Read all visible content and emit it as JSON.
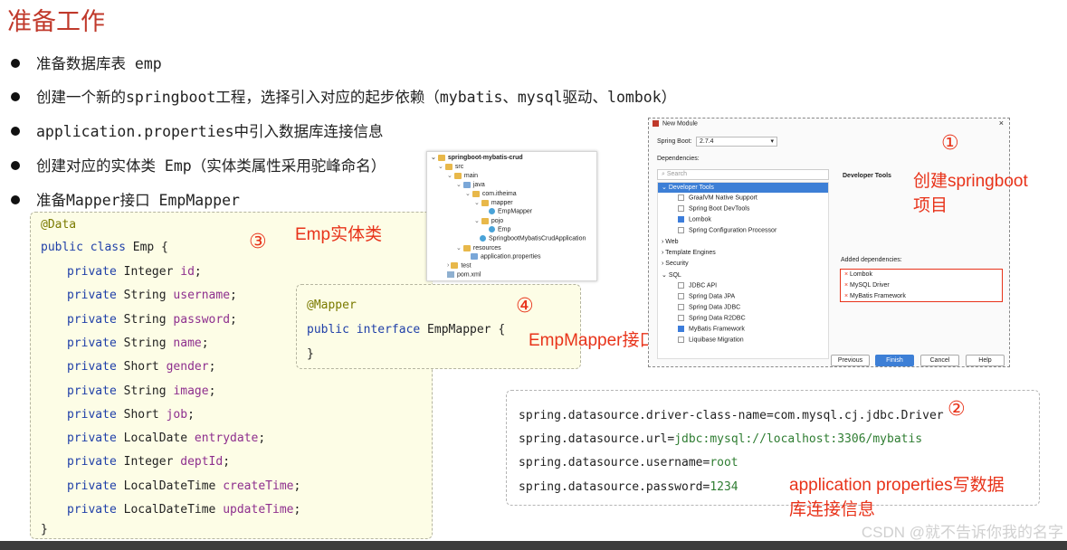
{
  "title": "准备工作",
  "bullets": [
    "准备数据库表 emp",
    "创建一个新的springboot工程，选择引入对应的起步依赖（mybatis、mysql驱动、lombok）",
    "application.properties中引入数据库连接信息",
    "创建对应的实体类 Emp（实体类属性采用驼峰命名）",
    "准备Mapper接口 EmpMapper"
  ],
  "emp_code": {
    "annotation": "@Data",
    "decl_kw": "public class",
    "decl_name": " Emp {",
    "fields": [
      {
        "kw": "private",
        "type": "Integer",
        "name": "id"
      },
      {
        "kw": "private",
        "type": "String",
        "name": "username"
      },
      {
        "kw": "private",
        "type": "String",
        "name": "password"
      },
      {
        "kw": "private",
        "type": "String",
        "name": "name"
      },
      {
        "kw": "private",
        "type": "Short",
        "name": "gender"
      },
      {
        "kw": "private",
        "type": "String",
        "name": "image"
      },
      {
        "kw": "private",
        "type": "Short",
        "name": "job"
      },
      {
        "kw": "private",
        "type": "LocalDate",
        "name": "entrydate"
      },
      {
        "kw": "private",
        "type": "Integer",
        "name": "deptId"
      },
      {
        "kw": "private",
        "type": "LocalDateTime",
        "name": "createTime"
      },
      {
        "kw": "private",
        "type": "LocalDateTime",
        "name": "updateTime"
      }
    ],
    "close": "}"
  },
  "mapper_code": {
    "annotation": "@Mapper",
    "decl_kw": "public interface",
    "decl_name": " EmpMapper {",
    "close": "}"
  },
  "labels": {
    "circle1": "①",
    "circle2": "②",
    "circle3": "③",
    "circle4": "④",
    "emp_label": "Emp实体类",
    "mapper_label": "EmpMapper接口类",
    "create_label_1": "创建springboot",
    "create_label_2": "项目",
    "props_label_1": "application properties写数据",
    "props_label_2": "库连接信息"
  },
  "tree": {
    "items": [
      "springboot-mybatis-crud",
      "src",
      "main",
      "java",
      "com.itheima",
      "mapper",
      "EmpMapper",
      "pojo",
      "Emp",
      "SpringbootMybatisCrudApplication",
      "resources",
      "application.properties",
      "test",
      "pom.xml"
    ]
  },
  "dialog": {
    "title": "New Module",
    "spring_boot_label": "Spring Boot:",
    "spring_boot_version": "2.7.4",
    "dependencies_label": "Dependencies:",
    "search_placeholder": "Search",
    "groups": [
      {
        "name": "Developer Tools",
        "selected": true
      },
      {
        "name": "GraalVM Native Support",
        "checked": false
      },
      {
        "name": "Spring Boot DevTools",
        "checked": false
      },
      {
        "name": "Lombok",
        "checked": true
      },
      {
        "name": "Spring Configuration Processor",
        "checked": false
      },
      {
        "name": "Web"
      },
      {
        "name": "Template Engines"
      },
      {
        "name": "Security"
      },
      {
        "name": "SQL"
      },
      {
        "name": "JDBC API",
        "checked": false
      },
      {
        "name": "Spring Data JPA",
        "checked": false
      },
      {
        "name": "Spring Data JDBC",
        "checked": false
      },
      {
        "name": "Spring Data R2DBC",
        "checked": false
      },
      {
        "name": "MyBatis Framework",
        "checked": true
      },
      {
        "name": "Liquibase Migration",
        "checked": false
      }
    ],
    "detail_title": "Developer Tools",
    "added_label": "Added dependencies:",
    "added": [
      "Lombok",
      "MySQL Driver",
      "MyBatis Framework"
    ],
    "buttons": {
      "previous": "Previous",
      "finish": "Finish",
      "cancel": "Cancel",
      "help": "Help"
    }
  },
  "props": [
    {
      "key": "spring.datasource.driver-class-name",
      "value": "com.mysql.cj.jdbc.Driver"
    },
    {
      "key": "spring.datasource.url",
      "value": "jdbc:mysql://localhost:3306/mybatis"
    },
    {
      "key": "spring.datasource.username",
      "value": "root"
    },
    {
      "key": "spring.datasource.password",
      "value": "1234"
    }
  ],
  "watermark": "CSDN @就不告诉你我的名字",
  "colors": {
    "accent_red": "#e8331a",
    "title_red": "#c0392b",
    "code_bg": "#fdfde6",
    "keyword": "#1f3fa8",
    "field": "#8e2f8e",
    "annotation": "#7a7a00",
    "props_value": "#2f7d32"
  }
}
